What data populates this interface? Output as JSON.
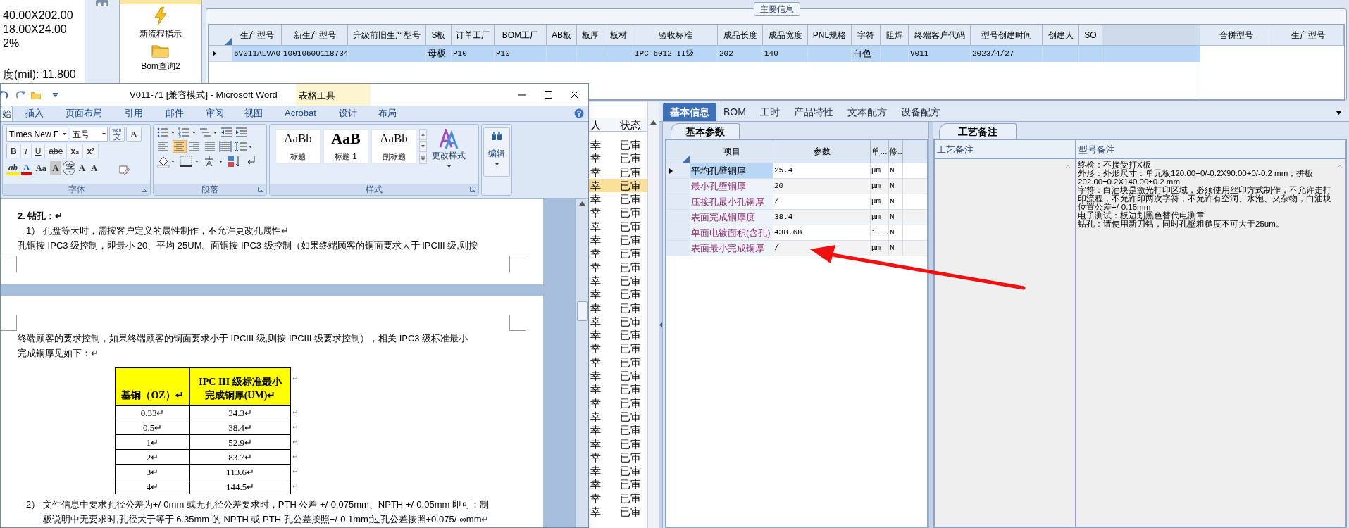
{
  "left_panel": {
    "lines": [
      "40.00X202.00",
      "18.00X24.00",
      "2%",
      "度(mil): 11.800"
    ]
  },
  "nav_menu": {
    "items": [
      {
        "kind": "lightning",
        "label": "新流程指示"
      },
      {
        "kind": "folder",
        "label": "Bom查询2"
      }
    ]
  },
  "main_info": {
    "title": "主要信息",
    "columns": [
      "生产型号",
      "新生产型号",
      "升级前旧生产型号",
      "S板",
      "订单工厂",
      "BOM工厂",
      "AB板",
      "板厚",
      "板材",
      "验收标准",
      "成品长度",
      "成品宽度",
      "PNL规格",
      "字符",
      "阻焊",
      "终端客户代码",
      "型号创建时间",
      "创建人",
      "SO"
    ],
    "rows": [
      {
        "selected": true,
        "cells": [
          "6V011ALVA0",
          "10010600118734",
          "",
          "母板",
          "P10",
          "P10",
          "",
          "",
          "",
          "IPC-6012 II级",
          "202",
          "140",
          "",
          "白色",
          "",
          "V011",
          "2023/4/27",
          "",
          ""
        ]
      }
    ],
    "merge_columns": [
      "合拼型号",
      "生产型号"
    ]
  },
  "record_list": {
    "columns": [
      "人",
      "状态"
    ],
    "rows": [
      {
        "selected": false,
        "cells": [
          "幸",
          "已审"
        ]
      },
      {
        "selected": false,
        "cells": [
          "幸",
          "已审"
        ]
      },
      {
        "selected": false,
        "cells": [
          "幸",
          "已审"
        ]
      },
      {
        "selected": true,
        "cells": [
          "幸",
          "已审"
        ]
      },
      {
        "selected": false,
        "cells": [
          "幸",
          "已审"
        ]
      },
      {
        "selected": false,
        "cells": [
          "幸",
          "已审"
        ]
      },
      {
        "selected": false,
        "cells": [
          "幸",
          "已审"
        ]
      },
      {
        "selected": false,
        "cells": [
          "幸",
          "已审"
        ]
      },
      {
        "selected": false,
        "cells": [
          "幸",
          "已审"
        ]
      },
      {
        "selected": false,
        "cells": [
          "幸",
          "已审"
        ]
      },
      {
        "selected": false,
        "cells": [
          "幸",
          "已审"
        ]
      },
      {
        "selected": false,
        "cells": [
          "幸",
          "已审"
        ]
      },
      {
        "selected": false,
        "cells": [
          "幸",
          "已审"
        ]
      },
      {
        "selected": false,
        "cells": [
          "幸",
          "已审"
        ]
      },
      {
        "selected": false,
        "cells": [
          "幸",
          "已审"
        ]
      },
      {
        "selected": false,
        "cells": [
          "幸",
          "已审"
        ]
      },
      {
        "selected": false,
        "cells": [
          "幸",
          "已审"
        ]
      },
      {
        "selected": false,
        "cells": [
          "幸",
          "已审"
        ]
      },
      {
        "selected": false,
        "cells": [
          "幸",
          "已审"
        ]
      },
      {
        "selected": false,
        "cells": [
          "幸",
          "已审"
        ]
      },
      {
        "selected": false,
        "cells": [
          "幸",
          "已审"
        ]
      },
      {
        "selected": false,
        "cells": [
          "幸",
          "已审"
        ]
      },
      {
        "selected": false,
        "cells": [
          "幸",
          "已审"
        ]
      },
      {
        "selected": false,
        "cells": [
          "幸",
          "已审"
        ]
      },
      {
        "selected": false,
        "cells": [
          "幸",
          "已审"
        ]
      },
      {
        "selected": false,
        "cells": [
          "幸",
          "已审"
        ]
      },
      {
        "selected": false,
        "cells": [
          "幸",
          "已审"
        ]
      },
      {
        "selected": false,
        "cells": [
          "幸",
          "已审"
        ]
      }
    ]
  },
  "detail_tabs": [
    {
      "label": "基本信息",
      "selected": true
    },
    {
      "label": "BOM",
      "selected": false
    },
    {
      "label": "工时",
      "selected": false
    },
    {
      "label": "产品特性",
      "selected": false
    },
    {
      "label": "文本配方",
      "selected": false
    },
    {
      "label": "设备配方",
      "selected": false
    }
  ],
  "basic_params": {
    "tab": "基本参数",
    "columns": [
      "项目",
      "参数",
      "单...",
      "修.."
    ],
    "rows": [
      {
        "selected": true,
        "cells": [
          "平均孔壁铜厚",
          "25.4",
          "μm",
          "N"
        ]
      },
      {
        "selected": false,
        "cells": [
          "最小孔壁铜厚",
          "20",
          "μm",
          "N"
        ]
      },
      {
        "selected": false,
        "cells": [
          "压接孔最小孔铜厚",
          "/",
          "μm",
          "N"
        ]
      },
      {
        "selected": false,
        "cells": [
          "表面完成铜厚度",
          "38.4",
          "μm",
          "N"
        ]
      },
      {
        "selected": false,
        "cells": [
          "单面电镀面积(含孔)",
          "438.68",
          "i...",
          "N"
        ]
      },
      {
        "selected": false,
        "cells": [
          "表面最小完成铜厚",
          "/",
          "μm",
          "N"
        ]
      }
    ]
  },
  "remarks": {
    "tab": "工艺备注",
    "columns": [
      "工艺备注",
      "型号备注"
    ],
    "model_note": [
      "终检：不接受打X板",
      "外形：外形尺寸：单元板120.00+0/-0.2X90.00+0/-0.2 mm；拼板",
      "202.00±0.2X140.00±0.2 mm",
      "字符：白油块是激光打印区域，必须使用丝印方式制作，不允许走打",
      "印流程，不允许印两次字符，不允许有空洞、水泡、夹杂物，白油块",
      "位置公差+/-0.15mm",
      "电子测试：板边划黑色替代电测章",
      "钻孔：请使用新刀钻，同时孔壁粗糙度不可大于25um。"
    ]
  },
  "word": {
    "title": "V011-71 [兼容模式] - Microsoft Word",
    "context_tab": "表格工具",
    "tabs": [
      {
        "label": "始",
        "selected": true
      },
      {
        "label": "插入",
        "selected": false
      },
      {
        "label": "页面布局",
        "selected": false
      },
      {
        "label": "引用",
        "selected": false
      },
      {
        "label": "邮件",
        "selected": false
      },
      {
        "label": "审阅",
        "selected": false
      },
      {
        "label": "视图",
        "selected": false
      },
      {
        "label": "Acrobat",
        "selected": false
      },
      {
        "label": "设计",
        "selected": false
      },
      {
        "label": "布局",
        "selected": false
      }
    ],
    "font_name": "Times New F",
    "font_size": "五号",
    "phonetic": {
      "top": "wén",
      "main": "文"
    },
    "char_border": "A",
    "format_buttons": [
      {
        "kind": "bold",
        "label": "B"
      },
      {
        "kind": "italic",
        "label": "I"
      },
      {
        "kind": "underline",
        "label": "U"
      },
      {
        "kind": "strike",
        "label": "abe"
      },
      {
        "kind": "subscript",
        "label": "x₂"
      },
      {
        "kind": "superscript",
        "label": "x²"
      }
    ],
    "font_effects": [
      {
        "kind": "highlight",
        "label": "ab"
      },
      {
        "kind": "color",
        "label": "A"
      },
      {
        "kind": "case",
        "label": "Aa"
      },
      {
        "kind": "shade",
        "label": "A"
      },
      {
        "kind": "enclose",
        "label": "字"
      },
      {
        "kind": "grow",
        "label": "A"
      },
      {
        "kind": "shrink",
        "label": "A"
      }
    ],
    "alignments": [
      {
        "kind": "left",
        "selected": false
      },
      {
        "kind": "center",
        "selected": true
      },
      {
        "kind": "right",
        "selected": false
      },
      {
        "kind": "justify",
        "selected": false
      },
      {
        "kind": "distributed",
        "selected": false
      }
    ],
    "quick_styles": [
      {
        "preview": "AaBb",
        "name": "标题"
      },
      {
        "preview": "AaB",
        "name": "标题 1"
      },
      {
        "preview": "AaBb",
        "name": "副标题"
      }
    ],
    "change_styles": "更改样式",
    "editing": "编辑",
    "groups": [
      "字体",
      "段落",
      "样式"
    ],
    "document": {
      "page1": [
        {
          "kind": "heading",
          "text": "2.  钻孔：↵"
        },
        {
          "kind": "item",
          "text": "1）  孔盘等大时，需按客户定义的属性制作，不允许更改孔属性↵"
        },
        {
          "kind": "body",
          "text": "孔铜按 IPC3 级控制，即最小 20、平均 25UM。面铜按 IPC3 级控制（如果终端顾客的铜面要求大于 IPCIII 级,则按"
        }
      ],
      "page2_before": [
        {
          "kind": "body",
          "text": "终端顾客的要求控制，如果终端顾客的铜面要求小于 IPCIII 级,则按 IPCIII 级要求控制），相关 IPC3 级标准最小"
        },
        {
          "kind": "body",
          "text": "完成铜厚见如下：↵"
        }
      ],
      "table": {
        "header": [
          "基铜（OZ）↵",
          "IPC III 级标准最小完成铜厚(UM)↵"
        ],
        "row_mark": "↵",
        "rows": [
          [
            "0.33↵",
            "34.3↵"
          ],
          [
            "0.5↵",
            "38.4↵"
          ],
          [
            "1↵",
            "52.9↵"
          ],
          [
            "2↵",
            "83.7↵"
          ],
          [
            "3↵",
            "113.6↵"
          ],
          [
            "4↵",
            "144.5↵"
          ]
        ]
      },
      "page2_after": [
        {
          "kind": "item",
          "text": "2）  文件信息中要求孔径公差为+/-0mm 或无孔径公差要求时，PTH 公差 +/-0.075mm、NPTH +/-0.05mm 即可；制"
        },
        {
          "kind": "continuation",
          "text": "板说明中无要求时,孔径大于等于 6.35mm 的 NPTH 或 PTH 孔公差按照+/-0.1mm;过孔公差按照+0.075/-∞mm↵"
        }
      ]
    }
  }
}
